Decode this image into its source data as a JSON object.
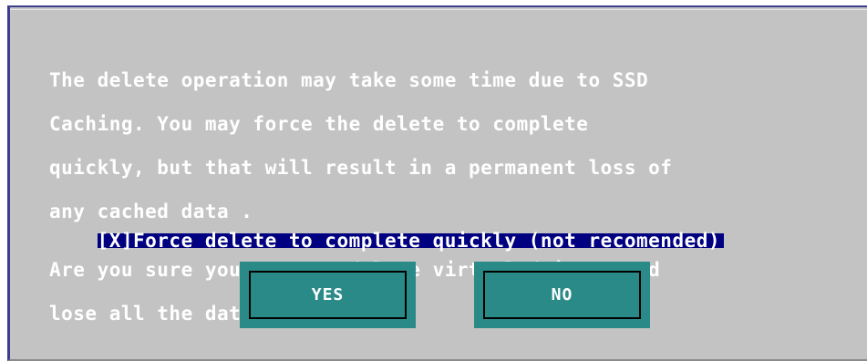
{
  "dialog": {
    "message_lines": [
      "The delete operation may take some time due to SSD",
      "Caching. You may force the delete to complete",
      "quickly, but that will result in a permanent loss of",
      "any cached data ."
    ],
    "force_option": "[X]Force delete to complete quickly (not recomended)",
    "confirm_lines": [
      "Are you sure you want to delete virtual drive 1 and",
      "lose all the data on it?"
    ],
    "yes_label": "YES",
    "no_label": "NO"
  },
  "colors": {
    "background": "#c3c3c3",
    "highlight": "#000080",
    "button": "#2a8a88",
    "text": "#ffffff"
  }
}
